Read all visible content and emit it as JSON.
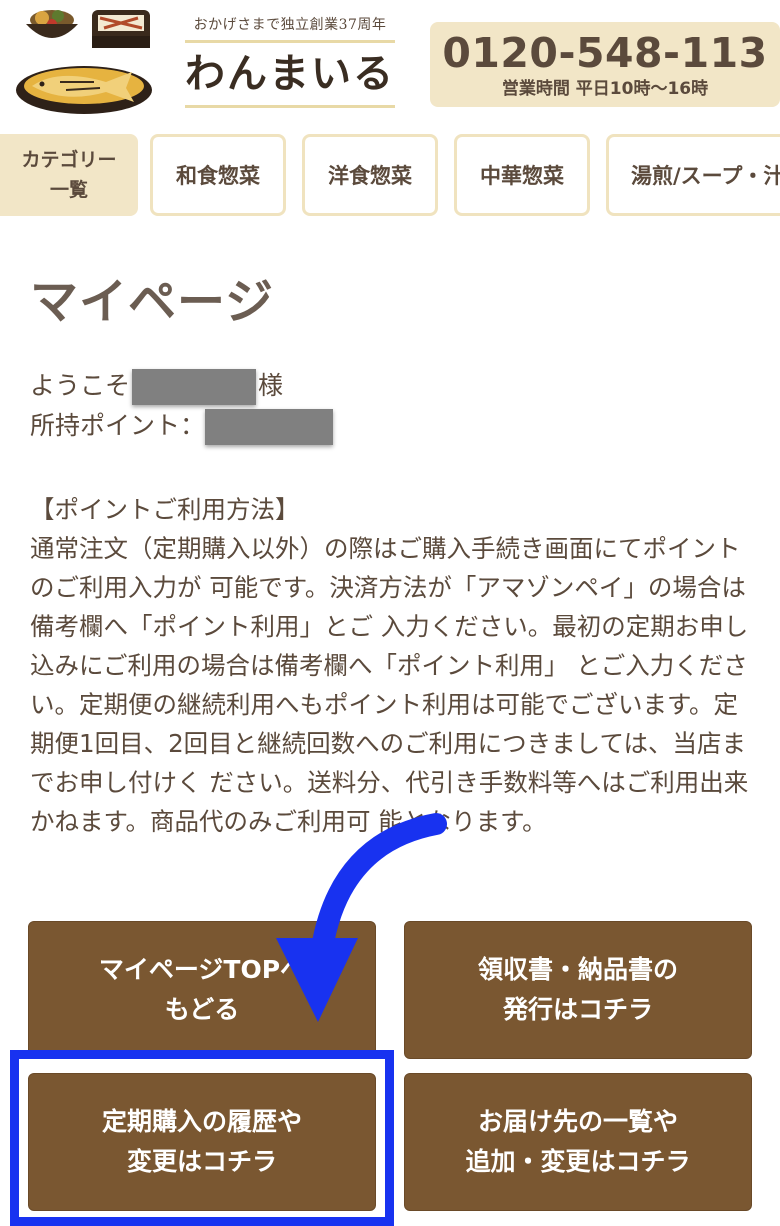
{
  "header": {
    "tagline": "おかげさまで独立創業37周年",
    "brand_name": "わんまいる",
    "phone_number": "0120-548-113",
    "business_hours": "営業時間 平日10時〜16時"
  },
  "categories": {
    "all_line1": "カテゴリー",
    "all_line2": "一覧",
    "items": [
      "和食惣菜",
      "洋食惣菜",
      "中華惣菜",
      "湯煎/スープ・汁"
    ]
  },
  "mypage": {
    "title": "マイページ",
    "welcome_prefix": "ようこそ",
    "welcome_suffix": "様",
    "points_label": "所持ポイント："
  },
  "points_info": {
    "heading": "【ポイントご利用方法】",
    "body": "通常注文（定期購入以外）の際はご購入手続き画面にてポイントのご利用入力が 可能です。決済方法が「アマゾンペイ」の場合は備考欄へ「ポイント利用」とご 入力ください。最初の定期お申し込みにご利用の場合は備考欄へ「ポイント利用」 とご入力ください。定期便の継続利用へもポイント利用は可能でございます。定 期便1回目、2回目と継続回数へのご利用につきましては、当店までお申し付けく ださい。送料分、代引き手数料等へはご利用出来かねます。商品代のみご利用可 能となります。"
  },
  "actions": {
    "mypage_top_line1": "マイページTOPへ",
    "mypage_top_line2": "もどる",
    "receipt_line1": "領収書・納品書の",
    "receipt_line2": "発行はコチラ",
    "subscription_line1": "定期購入の履歴や",
    "subscription_line2": "変更はコチラ",
    "address_line1": "お届け先の一覧や",
    "address_line2": "追加・変更はコチラ"
  },
  "colors": {
    "accent_brown": "#7a5731",
    "cream": "#f2e6c7",
    "text": "#5b4a3c",
    "highlight_blue": "#1832f0"
  },
  "icons": [
    "food-bowls-logo-icon",
    "callout-arrow-icon"
  ]
}
